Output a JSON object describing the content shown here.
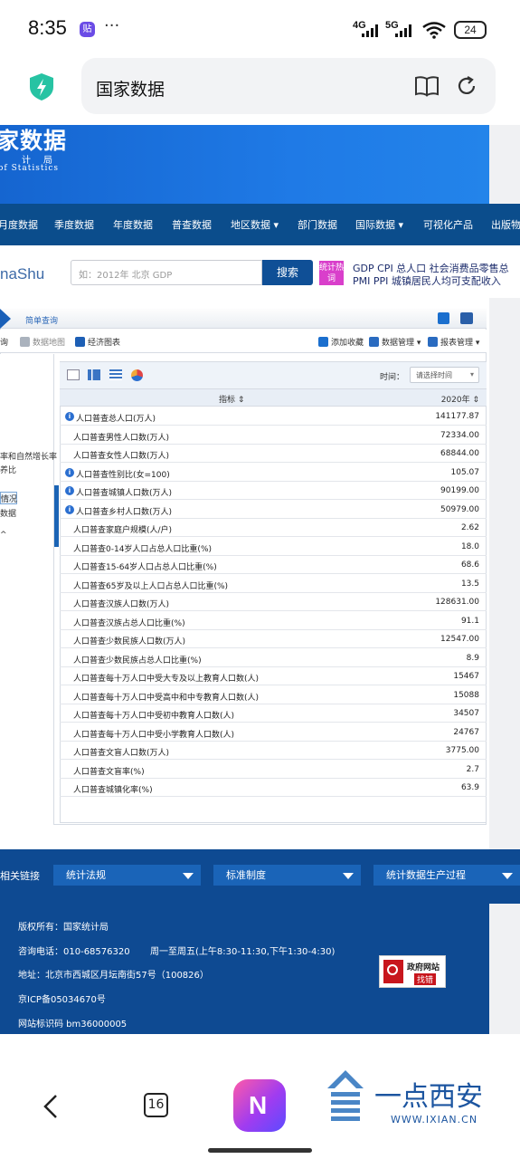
{
  "status_bar": {
    "time": "8:35",
    "app_badge": "贴",
    "more": "···",
    "net1": "4G",
    "net2": "5G",
    "battery": "24"
  },
  "browser": {
    "url_text": "国家数据",
    "icons": [
      "shield-icon",
      "reader-icon",
      "refresh-icon"
    ]
  },
  "banner": {
    "title": "家数据",
    "subtitle_cn": "计局",
    "subtitle_en": "of Statistics"
  },
  "nav": {
    "items": [
      "月度数据",
      "季度数据",
      "年度数据",
      "普查数据",
      "地区数据 ▾",
      "部门数据",
      "国际数据 ▾",
      "可视化产品",
      "出版物"
    ]
  },
  "search": {
    "brand": "naShu",
    "placeholder": "如：2012年 北京 GDP",
    "button": "搜索",
    "hot_label": "统计热词",
    "hot_words_line1": "GDP  CPI  总人口  社会消费品零售总",
    "hot_words_line2": "PMI  PPI  城镇居民人均可支配收入"
  },
  "breadcrumb": {
    "item": "简单查询"
  },
  "toolbar": {
    "left_cut": "询",
    "map": "数据地图",
    "chart": "经济图表",
    "add_fav": "添加收藏",
    "data_manage": "数据管理",
    "report_manage": "报表管理"
  },
  "left_tree": {
    "items": [
      "率和自然增长率",
      "养比",
      "情况",
      "数据",
      "^"
    ]
  },
  "table": {
    "time_label": "时间：",
    "time_select": "请选择时间",
    "col_indicator": "指标 ⇕",
    "col_year": "2020年 ⇕",
    "rows": [
      {
        "name": "人口普查总人口(万人)",
        "value": "141177.87",
        "info": true
      },
      {
        "name": "人口普查男性人口数(万人)",
        "value": "72334.00",
        "info": false
      },
      {
        "name": "人口普查女性人口数(万人)",
        "value": "68844.00",
        "info": false
      },
      {
        "name": "人口普查性别比(女=100)",
        "value": "105.07",
        "info": true
      },
      {
        "name": "人口普查城镇人口数(万人)",
        "value": "90199.00",
        "info": true
      },
      {
        "name": "人口普查乡村人口数(万人)",
        "value": "50979.00",
        "info": true
      },
      {
        "name": "人口普查家庭户规模(人/户)",
        "value": "2.62",
        "info": false
      },
      {
        "name": "人口普查0-14岁人口占总人口比重(%)",
        "value": "18.0",
        "info": false
      },
      {
        "name": "人口普查15-64岁人口占总人口比重(%)",
        "value": "68.6",
        "info": false
      },
      {
        "name": "人口普查65岁及以上人口占总人口比重(%)",
        "value": "13.5",
        "info": false
      },
      {
        "name": "人口普查汉族人口数(万人)",
        "value": "128631.00",
        "info": false
      },
      {
        "name": "人口普查汉族占总人口比重(%)",
        "value": "91.1",
        "info": false
      },
      {
        "name": "人口普查少数民族人口数(万人)",
        "value": "12547.00",
        "info": false
      },
      {
        "name": "人口普查少数民族占总人口比重(%)",
        "value": "8.9",
        "info": false
      },
      {
        "name": "人口普查每十万人口中受大专及以上教育人口数(人)",
        "value": "15467",
        "info": false
      },
      {
        "name": "人口普查每十万人口中受高中和中专教育人口数(人)",
        "value": "15088",
        "info": false
      },
      {
        "name": "人口普查每十万人口中受初中教育人口数(人)",
        "value": "34507",
        "info": false
      },
      {
        "name": "人口普查每十万人口中受小学教育人口数(人)",
        "value": "24767",
        "info": false
      },
      {
        "name": "人口普查文盲人口数(万人)",
        "value": "3775.00",
        "info": false
      },
      {
        "name": "人口普查文盲率(%)",
        "value": "2.7",
        "info": false
      },
      {
        "name": "人口普查城镇化率(%)",
        "value": "63.9",
        "info": false
      }
    ]
  },
  "links": {
    "label": "相关链接",
    "dropdowns": [
      "统计法规",
      "标准制度",
      "统计数据生产过程"
    ]
  },
  "footer": {
    "copyright": "版权所有：国家统计局",
    "phone": "咨询电话：010-68576320",
    "hours": "周一至周五(上午8:30-11:30,下午1:30-4:30)",
    "address": "地址：北京市西城区月坛南街57号（100826）",
    "icp": "京ICP备05034670号",
    "site_id": "网站标识码 bm36000005",
    "gov_badge_line1": "政府网站",
    "gov_badge_line2": "找错"
  },
  "bottom_nav": {
    "tabs": "16",
    "watermark_cn": "一点西安",
    "watermark_en": "WWW.IXIAN.CN"
  }
}
